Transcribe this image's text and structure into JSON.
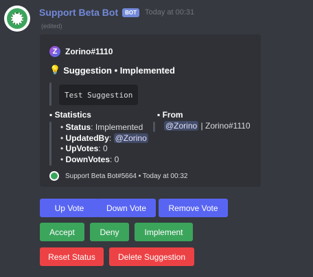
{
  "colors": {
    "background": "#36393f",
    "embed": "#2f3136",
    "username": "#7289da",
    "primary_button": "#5865f2",
    "success_button": "#3ba55c",
    "danger_button": "#ed4245"
  },
  "message": {
    "username": "Support Beta Bot",
    "badge": "BOT",
    "timestamp": "Today at 00:31",
    "edited": "(edited)"
  },
  "embed": {
    "author": "Zorino#1110",
    "title_icon": "lightbulb-icon",
    "title": "Suggestion • Implemented",
    "description_code": "Test Suggestion",
    "fields": {
      "statistics": {
        "name": "▪ Statistics",
        "lines": [
          {
            "label": "Status",
            "value": ": Implemented"
          },
          {
            "label": "UpdatedBy",
            "value": ": ",
            "mention": "@Zorino"
          },
          {
            "label": "UpVotes",
            "value": ": 0"
          },
          {
            "label": "DownVotes",
            "value": ": 0"
          }
        ]
      },
      "from": {
        "name": "▪ From",
        "mention": "@Zorino",
        "rest": " | Zorino#1110"
      }
    },
    "footer": {
      "text": "Support Beta Bot#5664 • Today at 00:32"
    }
  },
  "buttons": {
    "row1": [
      "Up Vote",
      "Down Vote",
      "Remove Vote"
    ],
    "row2": [
      "Accept",
      "Deny",
      "Implement"
    ],
    "row3": [
      "Reset Status",
      "Delete Suggestion"
    ]
  }
}
